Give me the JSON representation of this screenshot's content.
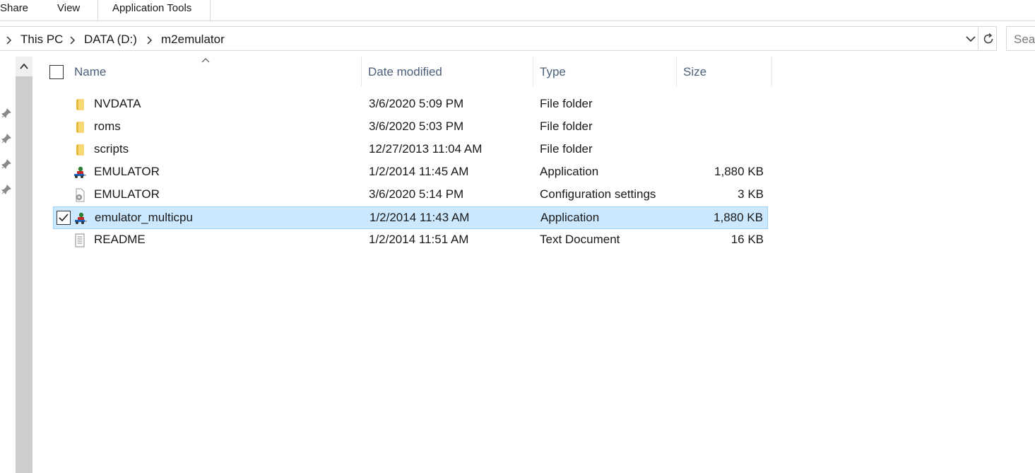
{
  "ribbon": {
    "tabs": [
      "Share",
      "View",
      "Application Tools"
    ]
  },
  "address": {
    "crumbs": [
      "This PC",
      "DATA (D:)",
      "m2emulator"
    ],
    "search_placeholder": "Sear"
  },
  "columns": {
    "name": "Name",
    "date": "Date modified",
    "type": "Type",
    "size": "Size"
  },
  "files": [
    {
      "name": "NVDATA",
      "date": "3/6/2020 5:09 PM",
      "type": "File folder",
      "size": "",
      "icon": "folder-icon"
    },
    {
      "name": "roms",
      "date": "3/6/2020 5:03 PM",
      "type": "File folder",
      "size": "",
      "icon": "folder-icon"
    },
    {
      "name": "scripts",
      "date": "12/27/2013 11:04 AM",
      "type": "File folder",
      "size": "",
      "icon": "folder-icon"
    },
    {
      "name": "EMULATOR",
      "date": "1/2/2014 11:45 AM",
      "type": "Application",
      "size": "1,880 KB",
      "icon": "application-icon"
    },
    {
      "name": "EMULATOR",
      "date": "3/6/2020 5:14 PM",
      "type": "Configuration settings",
      "size": "3 KB",
      "icon": "config-file-icon"
    },
    {
      "name": "emulator_multicpu",
      "date": "1/2/2014 11:43 AM",
      "type": "Application",
      "size": "1,880 KB",
      "icon": "application-icon",
      "selected": true
    },
    {
      "name": "README",
      "date": "1/2/2014 11:51 AM",
      "type": "Text Document",
      "size": "16 KB",
      "icon": "text-file-icon"
    }
  ],
  "colors": {
    "selection_bg": "#cce8ff",
    "selection_border": "#99d1ff",
    "header_text": "#4c607a",
    "folder": "#f8d775"
  }
}
